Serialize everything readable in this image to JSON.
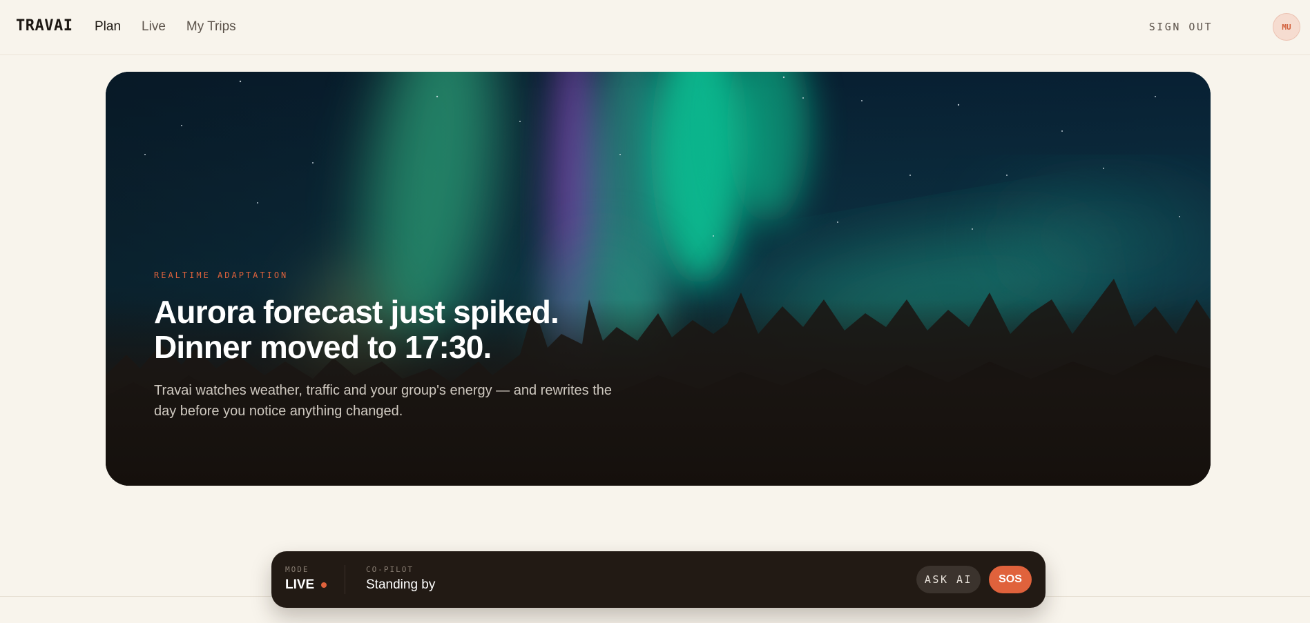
{
  "header": {
    "brand": "TRAVAI",
    "nav": [
      {
        "label": "Plan",
        "active": true
      },
      {
        "label": "Live",
        "active": false
      },
      {
        "label": "My Trips",
        "active": false
      }
    ],
    "sign_out": "SIGN OUT",
    "avatar_initials": "MU"
  },
  "hero": {
    "kicker": "REALTIME ADAPTATION",
    "headline_line1": "Aurora forecast just spiked.",
    "headline_line2": "Dinner moved to 17:30.",
    "subhead": "Travai watches weather, traffic and your group's energy — and rewrites the day before you notice anything changed.",
    "image": "aurora-over-pine-forest"
  },
  "dock": {
    "mode_label": "MODE",
    "mode_value": "LIVE",
    "copilot_label": "CO-PILOT",
    "copilot_value": "Standing by",
    "ask_ai": "ASK AI",
    "sos": "SOS"
  },
  "colors": {
    "accent": "#e0623c",
    "background": "#f8f4ec",
    "dock": "#221a14",
    "text": "#1c1712"
  }
}
